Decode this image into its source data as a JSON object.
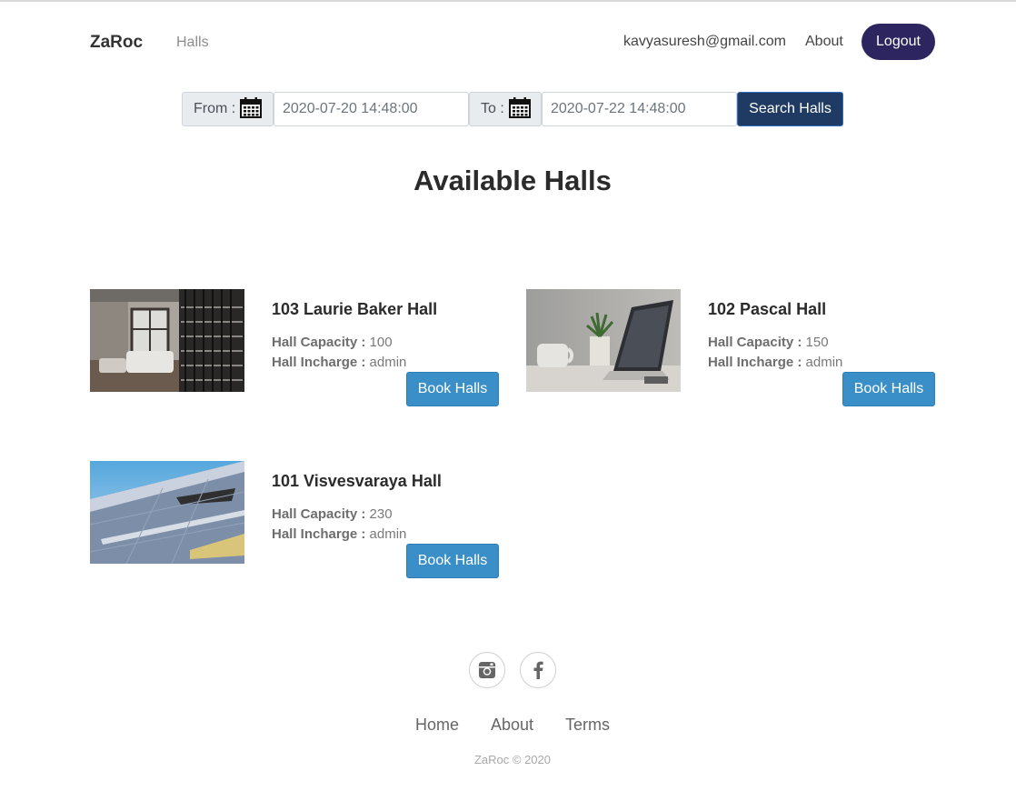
{
  "navbar": {
    "brand": "ZaRoc",
    "halls_link": "Halls",
    "user_email": "kavyasuresh@gmail.com",
    "about_link": "About",
    "logout_label": "Logout"
  },
  "search": {
    "from_label": "From :",
    "from_value": "2020-07-20 14:48:00",
    "to_label": "To :",
    "to_value": "2020-07-22 14:48:00",
    "button_label": "Search Halls",
    "icon": "calendar-icon"
  },
  "page_title": "Available Halls",
  "halls": [
    {
      "name": "103 Laurie Baker Hall",
      "capacity_label": "Hall Capacity :",
      "capacity": "100",
      "incharge_label": "Hall Incharge :",
      "incharge": "admin",
      "button_label": "Book Halls"
    },
    {
      "name": "102 Pascal Hall",
      "capacity_label": "Hall Capacity :",
      "capacity": "150",
      "incharge_label": "Hall Incharge :",
      "incharge": "admin",
      "button_label": "Book Halls"
    },
    {
      "name": "101 Visvesvaraya Hall",
      "capacity_label": "Hall Capacity :",
      "capacity": "230",
      "incharge_label": "Hall Incharge :",
      "incharge": "admin",
      "button_label": "Book Halls"
    }
  ],
  "footer": {
    "social_icons": [
      "instagram-icon",
      "facebook-icon"
    ],
    "links": [
      "Home",
      "About",
      "Terms"
    ],
    "copyright": "ZaRoc © 2020"
  },
  "colors": {
    "logout_bg": "#2d255f",
    "search_btn_bg": "#1f3b63",
    "book_btn_bg": "#3a8fc8"
  }
}
